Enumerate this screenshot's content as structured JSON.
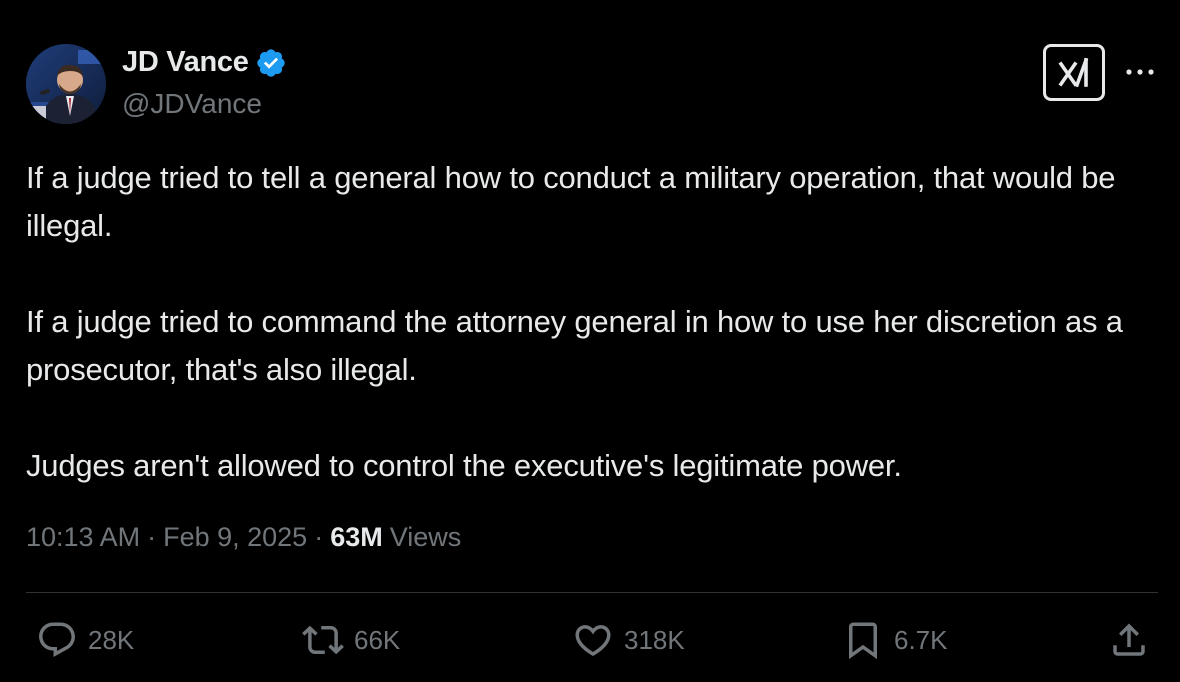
{
  "author": {
    "display_name": "JD Vance",
    "handle": "@JDVance",
    "verified": true,
    "verified_badge_color": "#1d9bf0"
  },
  "header_icons": {
    "grok": "grok-icon",
    "more": "more-icon"
  },
  "post": {
    "paragraphs": [
      "If a judge tried to tell a general how to conduct a military operation, that would be illegal.",
      "If a judge tried to command the attorney general in how to use her discretion as a prosecutor, that's also illegal.",
      "Judges aren't allowed to control the executive's legitimate power."
    ]
  },
  "meta": {
    "time": "10:13 AM",
    "separator": "·",
    "date": "Feb 9, 2025",
    "views_count": "63M",
    "views_label": "Views"
  },
  "actions": {
    "replies": "28K",
    "reposts": "66K",
    "likes": "318K",
    "bookmarks": "6.7K"
  },
  "colors": {
    "background": "#000000",
    "primary_text": "#e7e9ea",
    "secondary_text": "#71767b",
    "divider": "#2f3336"
  }
}
